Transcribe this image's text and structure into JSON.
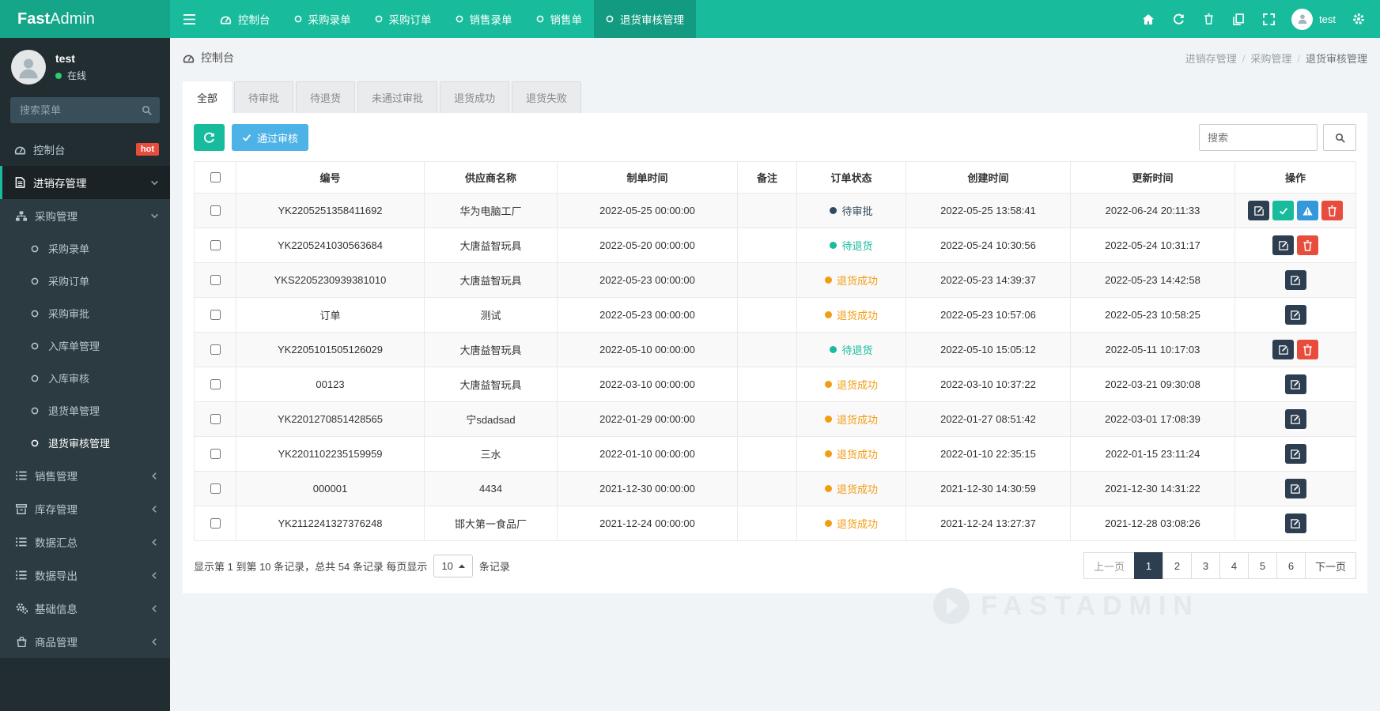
{
  "brand": {
    "bold": "Fast",
    "light": "Admin"
  },
  "topnav": {
    "tabs": [
      {
        "label": "控制台",
        "icon": "dashboard",
        "active": false
      },
      {
        "label": "采购录单",
        "icon": "circle",
        "active": false
      },
      {
        "label": "采购订单",
        "icon": "circle",
        "active": false
      },
      {
        "label": "销售录单",
        "icon": "circle",
        "active": false
      },
      {
        "label": "销售单",
        "icon": "circle",
        "active": false
      },
      {
        "label": "退货审核管理",
        "icon": "circle",
        "active": true
      }
    ],
    "action_icons": [
      "home",
      "refresh",
      "trash",
      "files",
      "fullscreen"
    ],
    "user": {
      "name": "test"
    },
    "settings_icon": "gear"
  },
  "sidebar": {
    "user": {
      "name": "test",
      "status": "在线"
    },
    "search_placeholder": "搜索菜单",
    "menu": [
      {
        "label": "控制台",
        "icon": "dashboard",
        "level": 1,
        "badge": "hot"
      },
      {
        "label": "进销存管理",
        "icon": "file-text",
        "level": 1,
        "chevron": "down",
        "highlight": true
      },
      {
        "label": "采购管理",
        "icon": "sitemap",
        "level": 2,
        "chevron": "down"
      },
      {
        "label": "采购录单",
        "icon": "circle",
        "level": 3
      },
      {
        "label": "采购订单",
        "icon": "circle",
        "level": 3
      },
      {
        "label": "采购审批",
        "icon": "circle",
        "level": 3
      },
      {
        "label": "入库单管理",
        "icon": "circle",
        "level": 3
      },
      {
        "label": "入库审核",
        "icon": "circle",
        "level": 3
      },
      {
        "label": "退货单管理",
        "icon": "circle",
        "level": 3
      },
      {
        "label": "退货审核管理",
        "icon": "circle",
        "level": 3,
        "active": true
      },
      {
        "label": "销售管理",
        "icon": "list",
        "level": 2,
        "chevron": "left"
      },
      {
        "label": "库存管理",
        "icon": "archive",
        "level": 2,
        "chevron": "left"
      },
      {
        "label": "数据汇总",
        "icon": "list",
        "level": 2,
        "chevron": "left"
      },
      {
        "label": "数据导出",
        "icon": "list",
        "level": 2,
        "chevron": "left"
      },
      {
        "label": "基础信息",
        "icon": "cogs",
        "level": 2,
        "chevron": "left"
      },
      {
        "label": "商品管理",
        "icon": "shopping-bag",
        "level": 2,
        "chevron": "left"
      }
    ]
  },
  "header": {
    "title": "控制台",
    "breadcrumb": [
      "进销存管理",
      "采购管理",
      "退货审核管理"
    ]
  },
  "filter_tabs": [
    {
      "label": "全部",
      "active": true
    },
    {
      "label": "待审批",
      "active": false
    },
    {
      "label": "待退货",
      "active": false
    },
    {
      "label": "未通过审批",
      "active": false
    },
    {
      "label": "退货成功",
      "active": false
    },
    {
      "label": "退货失败",
      "active": false
    }
  ],
  "toolbar": {
    "approve_label": "通过审核",
    "search_placeholder": "搜索"
  },
  "table": {
    "columns": [
      "编号",
      "供应商名称",
      "制单时间",
      "备注",
      "订单状态",
      "创建时间",
      "更新时间",
      "操作"
    ],
    "rows": [
      {
        "id": "YK2205251358411692",
        "supplier": "华为电脑工厂",
        "order_time": "2022-05-25 00:00:00",
        "remark": "",
        "status": {
          "label": "待审批",
          "type": "dark"
        },
        "created": "2022-05-25 13:58:41",
        "updated": "2022-06-24 20:11:33",
        "actions": [
          "edit",
          "approve",
          "warn",
          "del"
        ]
      },
      {
        "id": "YK2205241030563684",
        "supplier": "大唐益智玩具",
        "order_time": "2022-05-20 00:00:00",
        "remark": "",
        "status": {
          "label": "待退货",
          "type": "green"
        },
        "created": "2022-05-24 10:30:56",
        "updated": "2022-05-24 10:31:17",
        "actions": [
          "edit",
          "del"
        ]
      },
      {
        "id": "YKS2205230939381010",
        "supplier": "大唐益智玩具",
        "order_time": "2022-05-23 00:00:00",
        "remark": "",
        "status": {
          "label": "退货成功",
          "type": "orange"
        },
        "created": "2022-05-23 14:39:37",
        "updated": "2022-05-23 14:42:58",
        "actions": [
          "edit"
        ]
      },
      {
        "id": "订单",
        "supplier": "测试",
        "order_time": "2022-05-23 00:00:00",
        "remark": "",
        "status": {
          "label": "退货成功",
          "type": "orange"
        },
        "created": "2022-05-23 10:57:06",
        "updated": "2022-05-23 10:58:25",
        "actions": [
          "edit"
        ]
      },
      {
        "id": "YK2205101505126029",
        "supplier": "大唐益智玩具",
        "order_time": "2022-05-10 00:00:00",
        "remark": "",
        "status": {
          "label": "待退货",
          "type": "green"
        },
        "created": "2022-05-10 15:05:12",
        "updated": "2022-05-11 10:17:03",
        "actions": [
          "edit",
          "del"
        ]
      },
      {
        "id": "00123",
        "supplier": "大唐益智玩具",
        "order_time": "2022-03-10 00:00:00",
        "remark": "",
        "status": {
          "label": "退货成功",
          "type": "orange"
        },
        "created": "2022-03-10 10:37:22",
        "updated": "2022-03-21 09:30:08",
        "actions": [
          "edit"
        ]
      },
      {
        "id": "YK2201270851428565",
        "supplier": "宁sdadsad",
        "order_time": "2022-01-29 00:00:00",
        "remark": "",
        "status": {
          "label": "退货成功",
          "type": "orange"
        },
        "created": "2022-01-27 08:51:42",
        "updated": "2022-03-01 17:08:39",
        "actions": [
          "edit"
        ]
      },
      {
        "id": "YK2201102235159959",
        "supplier": "三水",
        "order_time": "2022-01-10 00:00:00",
        "remark": "",
        "status": {
          "label": "退货成功",
          "type": "orange"
        },
        "created": "2022-01-10 22:35:15",
        "updated": "2022-01-15 23:11:24",
        "actions": [
          "edit"
        ]
      },
      {
        "id": "000001",
        "supplier": "4434",
        "order_time": "2021-12-30 00:00:00",
        "remark": "",
        "status": {
          "label": "退货成功",
          "type": "orange"
        },
        "created": "2021-12-30 14:30:59",
        "updated": "2021-12-30 14:31:22",
        "actions": [
          "edit"
        ]
      },
      {
        "id": "YK2112241327376248",
        "supplier": "邯大第一食品厂",
        "order_time": "2021-12-24 00:00:00",
        "remark": "",
        "status": {
          "label": "退货成功",
          "type": "orange"
        },
        "created": "2021-12-24 13:27:37",
        "updated": "2021-12-28 03:08:26",
        "actions": [
          "edit"
        ]
      }
    ]
  },
  "footer": {
    "summary_prefix": "显示第 1 到第 10 条记录，总共 54 条记录 每页显示",
    "page_size": "10",
    "summary_suffix": "条记录",
    "pages": [
      {
        "label": "上一页",
        "disabled": true
      },
      {
        "label": "1",
        "active": true
      },
      {
        "label": "2"
      },
      {
        "label": "3"
      },
      {
        "label": "4"
      },
      {
        "label": "5"
      },
      {
        "label": "6"
      },
      {
        "label": "下一页"
      }
    ]
  },
  "watermark": "FASTADMIN",
  "colors": {
    "navbar": "#18bc9c",
    "brand_bg": "#15a589",
    "navbar_active": "#129b80",
    "sidebar": "#222d32",
    "submenu_bg": "#2c3b41",
    "primary": "#2c3e50",
    "success": "#18bc9c",
    "info": "#3498db",
    "danger": "#e74c3c",
    "status_pending": "#34495e",
    "status_waiting_return": "#18bc9c",
    "status_return_success": "#f39c12"
  }
}
